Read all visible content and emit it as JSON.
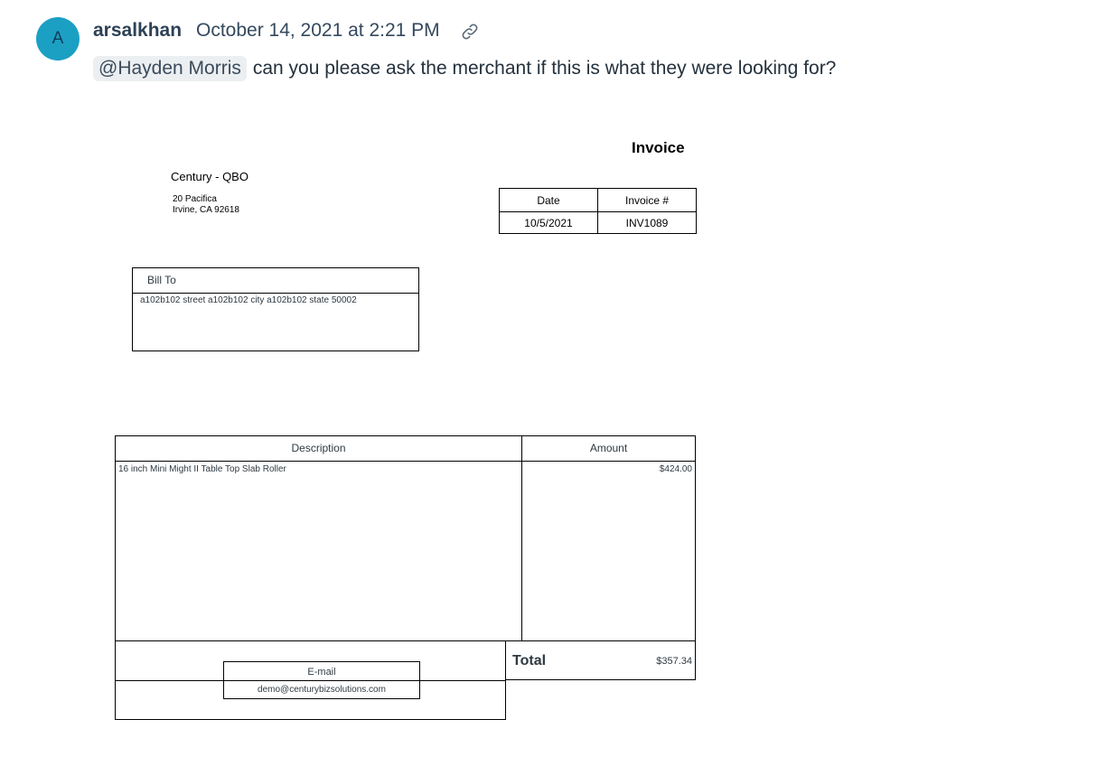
{
  "comment": {
    "avatar_initial": "A",
    "author": "arsalkhan",
    "timestamp": "October 14, 2021 at 2:21 PM",
    "link_icon": "link-icon",
    "mention": "@Hayden Morris",
    "message": "can you please ask the merchant if this is what they were looking for?"
  },
  "invoice": {
    "title": "Invoice",
    "company": "Century - QBO",
    "address_line1": "20 Pacifica",
    "address_line2": "Irvine, CA 92618",
    "meta_headers": [
      "Date",
      "Invoice #"
    ],
    "meta_values": [
      "10/5/2021",
      "INV1089"
    ],
    "bill_to_label": "Bill To",
    "bill_to_value": "a102b102 street a102b102 city a102b102 state 50002",
    "col_description": "Description",
    "col_amount": "Amount",
    "line_item_description": "16 inch Mini Might II Table Top Slab Roller",
    "line_item_amount": "$424.00",
    "total_label": "Total",
    "total_value": "$357.34",
    "email_label": "E-mail",
    "email_value": "demo@centurybizsolutions.com"
  },
  "colors": {
    "avatar_bg": "#1ba0c4",
    "mention_bg": "#eceff1",
    "author_text": "#2d4156"
  }
}
